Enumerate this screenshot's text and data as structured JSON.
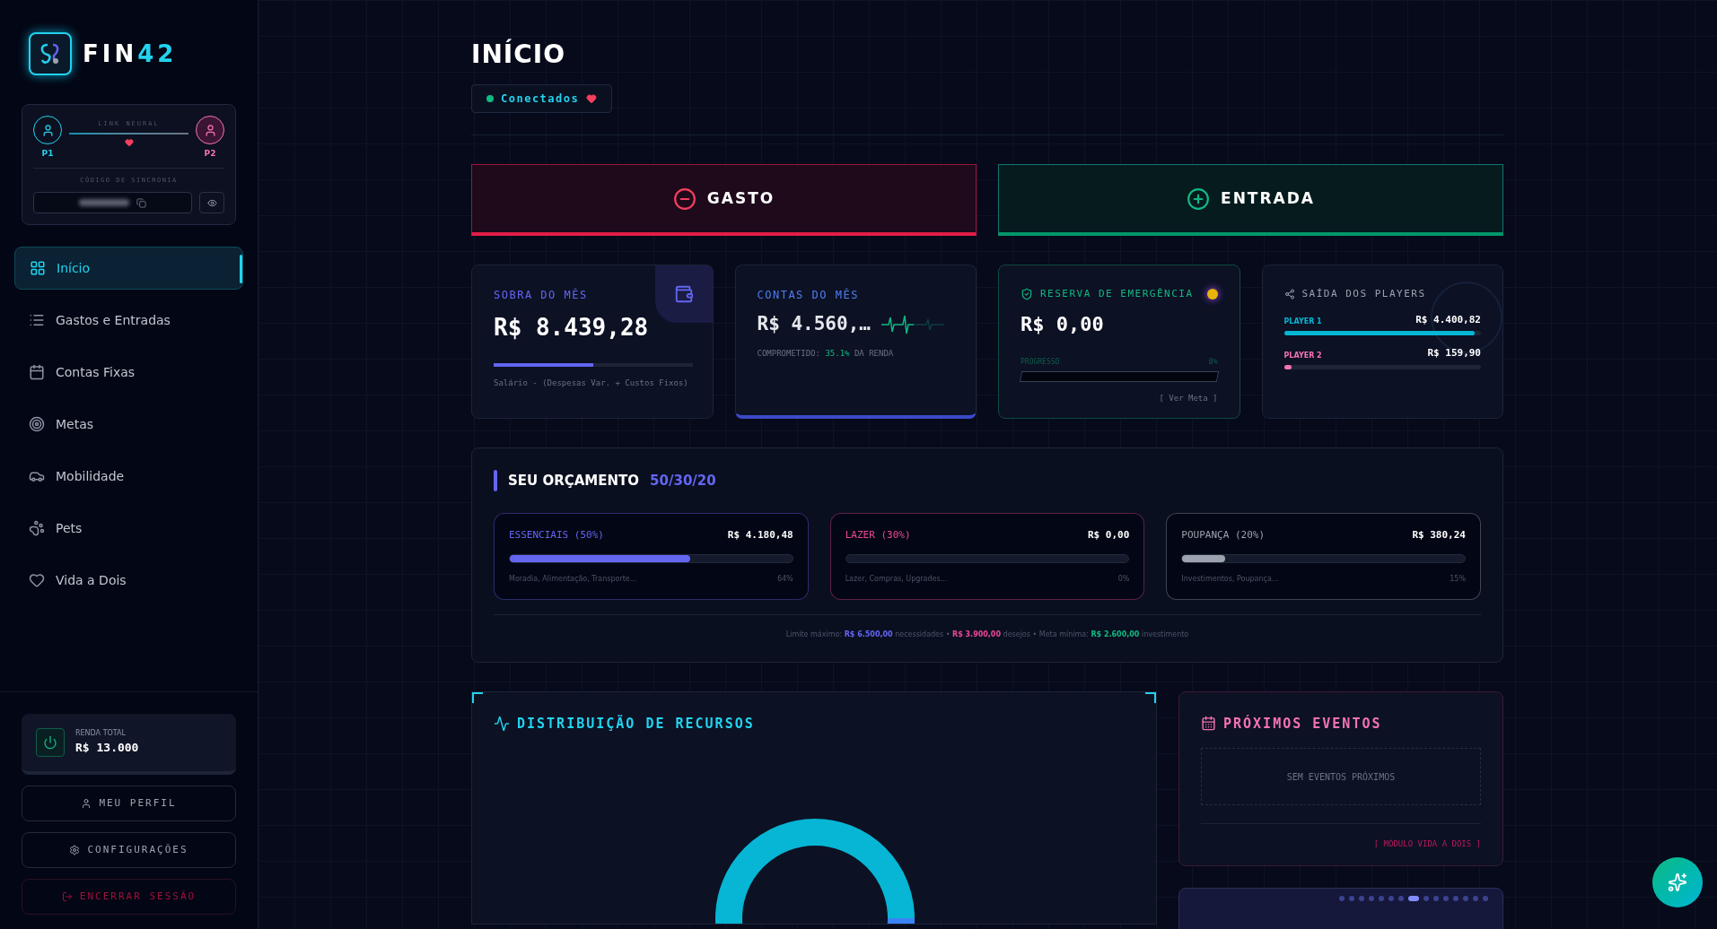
{
  "brand": {
    "name_a": "FIN",
    "name_b": "42"
  },
  "link": {
    "title": "LINK NEURAL",
    "p1": "P1",
    "p2": "P2",
    "sync_label": "CÓDIGO DE SINCRONIA"
  },
  "nav": [
    {
      "label": "Início",
      "kind": "grid",
      "selected": true
    },
    {
      "label": "Gastos e Entradas",
      "kind": "list",
      "selected": false
    },
    {
      "label": "Contas Fixas",
      "kind": "calendar",
      "selected": false
    },
    {
      "label": "Metas",
      "kind": "target",
      "selected": false
    },
    {
      "label": "Mobilidade",
      "kind": "car",
      "selected": false
    },
    {
      "label": "Pets",
      "kind": "paw",
      "selected": false
    },
    {
      "label": "Vida a Dois",
      "kind": "heart",
      "selected": false
    }
  ],
  "income": {
    "label": "RENDA TOTAL",
    "value": "R$ 13.000"
  },
  "sidebar_buttons": [
    {
      "label": "MEU PERFIL",
      "kind": "profile"
    },
    {
      "label": "CONFIGURAÇÕES",
      "kind": "settings"
    },
    {
      "label": "ENCERRAR SESSÃO",
      "kind": "logout"
    }
  ],
  "page": {
    "title": "INÍCIO",
    "status": "Conectados"
  },
  "actions": [
    {
      "label": "GASTO",
      "kind": "expense"
    },
    {
      "label": "ENTRADA",
      "kind": "income"
    }
  ],
  "stats": {
    "surplus": {
      "label": "SOBRA DO MÊS",
      "value": "R$ 8.439,28",
      "level": 0.5,
      "note": "Salário - (Despesas Var. + Custos Fixos)"
    },
    "bills": {
      "label": "CONTAS DO MÊS",
      "value": "R$ 4.560,…",
      "note_a": "COMPROMETIDO:",
      "note_pct": "35.1%",
      "note_b": "DA RENDA"
    },
    "reserve": {
      "label": "RESERVA DE EMERGÊNCIA",
      "value": "R$ 0,00",
      "progress_label": "PROGRESSO",
      "progress_pct": "0%",
      "level": 0,
      "link": "[ Ver Meta ]"
    },
    "players": {
      "label": "SAÍDA DOS PLAYERS",
      "items": [
        {
          "name": "PLAYER 1",
          "value": "R$ 4.400,82",
          "level": 0.97,
          "color": "#06b6d4"
        },
        {
          "name": "PLAYER 2",
          "value": "R$ 159,90",
          "level": 0.04,
          "color": "#f472b6"
        }
      ]
    }
  },
  "budget": {
    "title": "SEU ORÇAMENTO",
    "ratio": "50/30/20",
    "items": [
      {
        "name": "ESSENCIAIS (50%)",
        "value": "R$ 4.180,48",
        "level": 0.64,
        "desc": "Moradia, Alimentação, Transporte...",
        "pct": "64%",
        "color": "#6366f1"
      },
      {
        "name": "LAZER (30%)",
        "value": "R$ 0,00",
        "level": 0,
        "desc": "Lazer, Compras, Upgrades...",
        "pct": "0%",
        "color": "#ec4899"
      },
      {
        "name": "POUPANÇA (20%)",
        "value": "R$ 380,24",
        "level": 0.15,
        "desc": "Investimentos, Poupança...",
        "pct": "15%",
        "color": "#9ca3af"
      }
    ],
    "footer": [
      {
        "text": "Limite máximo: ",
        "kind": "plain"
      },
      {
        "text": "R$ 6.500,00",
        "kind": "needs"
      },
      {
        "text": " necessidades • ",
        "kind": "plain"
      },
      {
        "text": "R$ 3.900,00",
        "kind": "wants"
      },
      {
        "text": " desejos • Meta mínima: ",
        "kind": "plain"
      },
      {
        "text": "R$ 2.600,00",
        "kind": "invest"
      },
      {
        "text": " investimento",
        "kind": "plain"
      }
    ]
  },
  "distribution": {
    "title": "DISTRIBUIÇÃO DE RECURSOS"
  },
  "events": {
    "title": "PRÓXIMOS EVENTOS",
    "empty": "SEM EVENTOS PRÓXIMOS",
    "link": "[ MÓDULO VIDA A DOIS ]"
  },
  "carousel": [
    {
      "selected": false
    },
    {
      "selected": false
    },
    {
      "selected": false
    },
    {
      "selected": false
    },
    {
      "selected": false
    },
    {
      "selected": false
    },
    {
      "selected": false
    },
    {
      "selected": true
    },
    {
      "selected": false
    },
    {
      "selected": false
    },
    {
      "selected": false
    },
    {
      "selected": false
    },
    {
      "selected": false
    },
    {
      "selected": false
    },
    {
      "selected": false
    }
  ]
}
